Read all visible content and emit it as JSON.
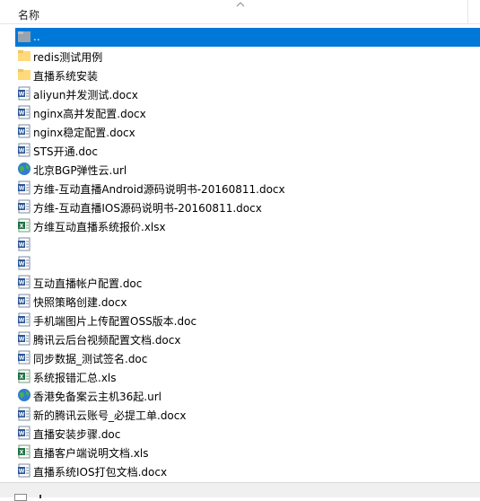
{
  "header": {
    "column_name": "名称"
  },
  "colors": {
    "selection": "#0078d7",
    "folder": "#ffd97a",
    "word": "#2b5797",
    "excel": "#217346"
  },
  "rows": [
    {
      "label": "..",
      "type": "parent",
      "selected": true
    },
    {
      "label": "redis测试用例",
      "type": "folder"
    },
    {
      "label": "直播系统安装",
      "type": "folder"
    },
    {
      "label": "aliyun并发测试.docx",
      "type": "word"
    },
    {
      "label": "nginx高并发配置.docx",
      "type": "word"
    },
    {
      "label": "nginx稳定配置.docx",
      "type": "word"
    },
    {
      "label": "STS开通.doc",
      "type": "word"
    },
    {
      "label": "北京BGP弹性云.url",
      "type": "url"
    },
    {
      "label": "方维-互动直播Android源码说明书-20160811.docx",
      "type": "word"
    },
    {
      "label": "方维-互动直播IOS源码说明书-20160811.docx",
      "type": "word"
    },
    {
      "label": "方维互动直播系统报价.xlsx",
      "type": "excel"
    },
    {
      "label": "",
      "type": "word"
    },
    {
      "label": "",
      "type": "word"
    },
    {
      "label": "互动直播帐户配置.doc",
      "type": "word"
    },
    {
      "label": "快照策略创建.docx",
      "type": "word"
    },
    {
      "label": "手机端图片上传配置OSS版本.doc",
      "type": "word"
    },
    {
      "label": "腾讯云后台视频配置文档.docx",
      "type": "word"
    },
    {
      "label": "同步数据_测试签名.doc",
      "type": "word"
    },
    {
      "label": "系统报错汇总.xls",
      "type": "excel"
    },
    {
      "label": "香港免备案云主机36起.url",
      "type": "url"
    },
    {
      "label": "新的腾讯云账号_必提工单.docx",
      "type": "word"
    },
    {
      "label": "直播安装步骤.doc",
      "type": "word"
    },
    {
      "label": "直播客户端说明文档.xls",
      "type": "excel"
    },
    {
      "label": "直播系统IOS打包文档.docx",
      "type": "word"
    }
  ]
}
